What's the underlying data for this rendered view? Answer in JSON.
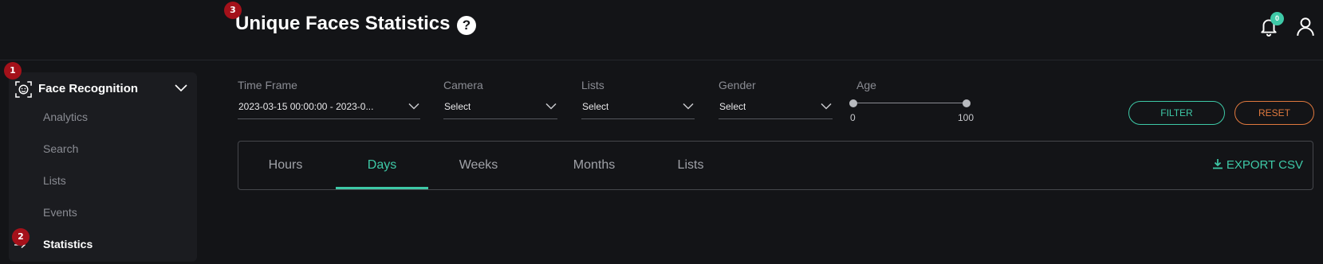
{
  "header": {
    "title": "Unique Faces Statistics",
    "notification_count": "0"
  },
  "markers": [
    "1",
    "2",
    "3"
  ],
  "sidebar": {
    "section_label": "Face Recognition",
    "items": [
      {
        "label": "Analytics"
      },
      {
        "label": "Search"
      },
      {
        "label": "Lists"
      },
      {
        "label": "Events"
      },
      {
        "label": "Statistics",
        "active": true
      }
    ]
  },
  "filters": {
    "time_frame": {
      "label": "Time Frame",
      "value": "2023-03-15 00:00:00 - 2023-0..."
    },
    "camera": {
      "label": "Camera",
      "value": "Select"
    },
    "lists": {
      "label": "Lists",
      "value": "Select"
    },
    "gender": {
      "label": "Gender",
      "value": "Select"
    },
    "age": {
      "label": "Age",
      "min": "0",
      "max": "100"
    },
    "filter_button": "FILTER",
    "reset_button": "RESET"
  },
  "tabs": [
    {
      "label": "Hours"
    },
    {
      "label": "Days",
      "active": true
    },
    {
      "label": "Weeks"
    },
    {
      "label": "Months"
    },
    {
      "label": "Lists"
    }
  ],
  "export_label": "EXPORT CSV",
  "colors": {
    "accent": "#3ec9a7",
    "reset": "#e0793e",
    "marker": "#a4111a",
    "background": "#131417"
  }
}
